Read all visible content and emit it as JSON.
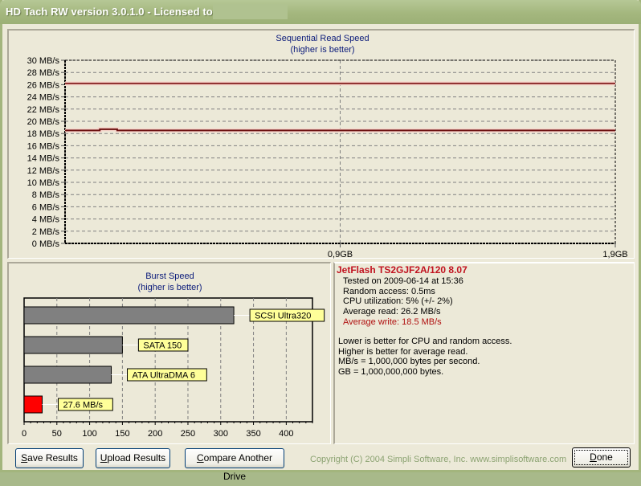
{
  "window": {
    "title": "HD Tach RW version 3.0.1.0 - Licensed to"
  },
  "sequential_chart": {
    "title": "Sequential Read Speed",
    "subtitle": "(higher is better)"
  },
  "burst_chart": {
    "title": "Burst Speed",
    "subtitle": "(higher is better)"
  },
  "chart_data": [
    {
      "type": "line",
      "title": "Sequential Read Speed",
      "subtitle": "(higher is better)",
      "ylabel": "MB/s",
      "ylim": [
        0,
        30
      ],
      "yticks": [
        "0 MB/s",
        "2 MB/s",
        "4 MB/s",
        "6 MB/s",
        "8 MB/s",
        "10 MB/s",
        "12 MB/s",
        "14 MB/s",
        "16 MB/s",
        "18 MB/s",
        "20 MB/s",
        "22 MB/s",
        "24 MB/s",
        "26 MB/s",
        "28 MB/s",
        "30 MB/s"
      ],
      "xticks": [
        "0,9GB",
        "1,9GB"
      ],
      "xlim_gb": [
        0,
        1.9
      ],
      "grid": true,
      "series": [
        {
          "name": "Average read",
          "color": "#8b2a2a",
          "x": [
            0,
            1.9
          ],
          "values": [
            26.2,
            26.2
          ]
        },
        {
          "name": "Sequential read",
          "color": "#6b0f0f",
          "x": [
            0,
            0.12,
            0.12,
            0.18,
            0.18,
            1.9
          ],
          "values": [
            18.5,
            18.5,
            18.7,
            18.7,
            18.5,
            18.5
          ]
        }
      ]
    },
    {
      "type": "bar",
      "title": "Burst Speed",
      "subtitle": "(higher is better)",
      "orientation": "horizontal",
      "xlim": [
        0,
        440
      ],
      "xticks": [
        "0",
        "50",
        "100",
        "150",
        "200",
        "250",
        "300",
        "350",
        "400"
      ],
      "grid": true,
      "categories": [
        "SCSI Ultra320",
        "SATA 150",
        "ATA UltraDMA 6",
        "27.6 MB/s"
      ],
      "values": [
        320,
        150,
        133,
        27.6
      ],
      "colors": [
        "#808080",
        "#808080",
        "#808080",
        "#ff0000"
      ]
    }
  ],
  "info": {
    "drive": "JetFlash TS2GJF2A/120 8.07",
    "tested": "Tested on 2009-06-14 at 15:36",
    "random_access": "Random access: 0.5ms",
    "cpu": "CPU utilization: 5% (+/- 2%)",
    "avg_read": "Average read: 26.2 MB/s",
    "avg_write": "Average write: 18.5 MB/s",
    "notes": [
      "Lower is better for CPU and random access.",
      "Higher is better for average read.",
      "MB/s = 1,000,000 bytes per second.",
      "GB = 1,000,000,000 bytes."
    ]
  },
  "buttons": {
    "save": "Save Results",
    "upload": "Upload Results",
    "compare": "Compare Another Drive",
    "done": "Done"
  },
  "copyright": "Copyright (C) 2004 Simpli Software, Inc. www.simplisoftware.com"
}
